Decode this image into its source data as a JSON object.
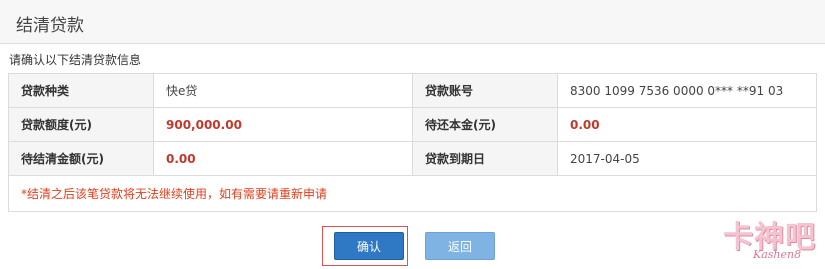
{
  "panel": {
    "title": "结清贷款"
  },
  "confirm_tip": "请确认以下结清贷款信息",
  "loan_info": {
    "row1": {
      "label_left": "贷款种类",
      "value_left": "快e贷",
      "label_right": "贷款账号",
      "value_right": "8300 1099 7536 0000 0*** **91 03"
    },
    "row2": {
      "label_left": "贷款额度(元)",
      "value_left": "900,000.00",
      "label_right": "待还本金(元)",
      "value_right": "0.00"
    },
    "row3": {
      "label_left": "待结清金额(元)",
      "value_left": "0.00",
      "label_right": "贷款到期日",
      "value_right": "2017-04-05"
    },
    "note": "*结清之后该笔贷款将无法继续使用，如有需要请重新申请"
  },
  "buttons": {
    "confirm_label": "确认",
    "back_label": "返回"
  },
  "watermark": {
    "text": "卡神吧",
    "sub_text": "Kashen8"
  },
  "colors": {
    "primary_button": "#2f78c4",
    "secondary_button": "#7fb3e3",
    "amount_red": "#c0392b",
    "note_red": "#e0401e"
  }
}
